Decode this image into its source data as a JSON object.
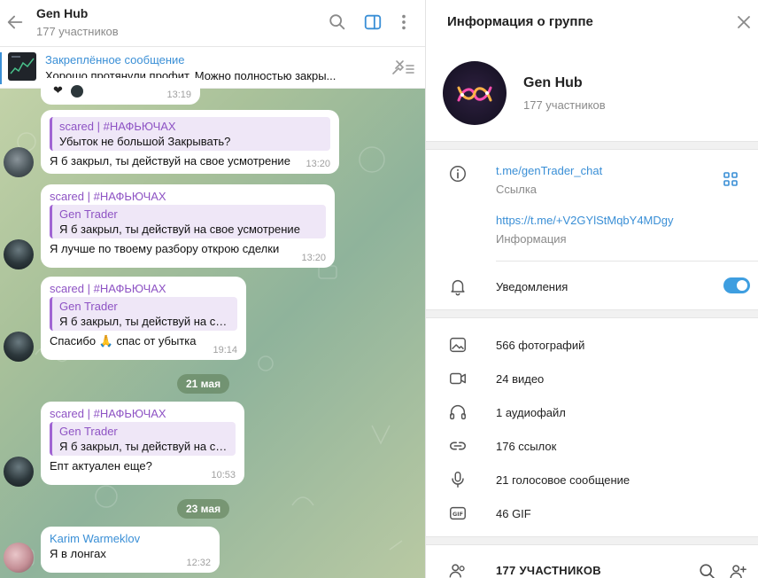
{
  "chat": {
    "title": "Gen Hub",
    "subtitle": "177 участников",
    "pinned": {
      "title": "Закреплённое сообщение",
      "text": "Хорошо протянули профит. Можно полностью закры..."
    },
    "messages": [
      {
        "time": "13:19"
      },
      {
        "quote_name": "scared | #НАФЬЮЧАХ",
        "quote_text": "Убыток не большой  Закрывать?",
        "text": "Я б закрыл, ты действуй на свое усмотрение",
        "time": "13:20"
      },
      {
        "sender": "scared | #НАФЬЮЧАХ",
        "quote_name": "Gen Trader",
        "quote_text": "Я б закрыл, ты действуй на свое усмотрение",
        "text": "Я лучше по твоему разбору открою сделки",
        "time": "13:20"
      },
      {
        "sender": "scared | #НАФЬЮЧАХ",
        "quote_name": "Gen Trader",
        "quote_text": "Я б закрыл, ты действуй на св...",
        "text": "Спасибо 🙏 спас от убытка",
        "time": "19:14"
      },
      {
        "sender": "scared | #НАФЬЮЧАХ",
        "quote_name": "Gen Trader",
        "quote_text": "Я б закрыл, ты действуй на св...",
        "text": "Епт актуален еще?",
        "time": "10:53"
      },
      {
        "sender": "Karim Warmeklov",
        "text": "Я в лонгах",
        "time": "12:32"
      }
    ],
    "dates": [
      "21 мая",
      "23 мая"
    ]
  },
  "info": {
    "header": "Информация о группе",
    "group_name": "Gen Hub",
    "group_count": "177 участников",
    "link": "t.me/genTrader_chat",
    "link_label": "Ссылка",
    "invite": "https://t.me/+V2GYlStMqbY4MDgy",
    "invite_label": "Информация",
    "notifications": "Уведомления",
    "notifications_on": true,
    "media": [
      {
        "icon": "photo-icon",
        "label": "566 фотографий"
      },
      {
        "icon": "video-icon",
        "label": "24 видео"
      },
      {
        "icon": "headphones-icon",
        "label": "1 аудиофайл"
      },
      {
        "icon": "link-icon",
        "label": "176 ссылок"
      },
      {
        "icon": "microphone-icon",
        "label": "21 голосовое сообщение"
      },
      {
        "icon": "gif-icon",
        "label": "46 GIF"
      }
    ],
    "members_title": "177 УЧАСТНИКОВ"
  },
  "colors": {
    "accent": "#3a8fd6",
    "quote": "#8e53c4",
    "toggle": "#3e9ee0"
  }
}
